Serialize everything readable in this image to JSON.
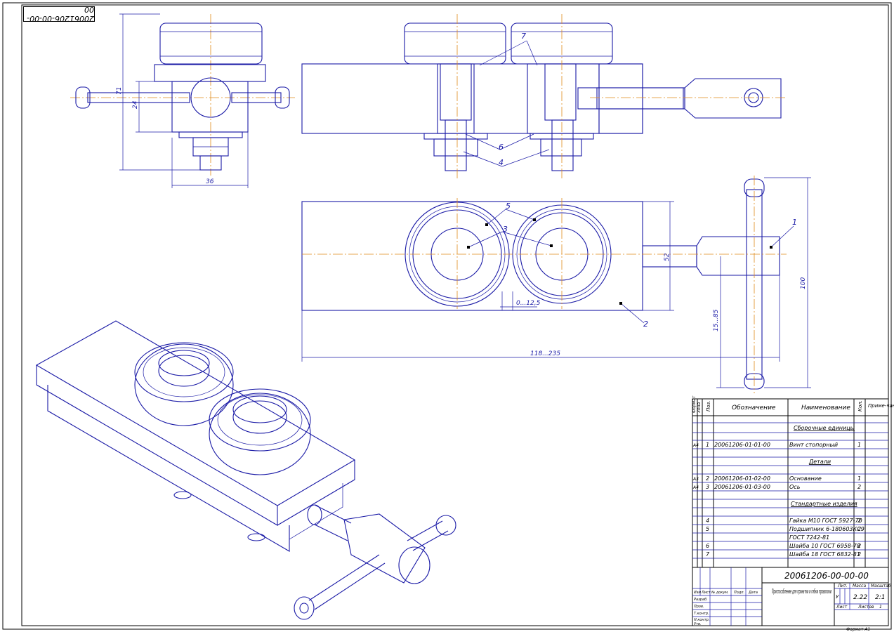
{
  "drawing_code_rotated": "20061206-00-00-00",
  "dims": {
    "d36": "36",
    "d71": "71",
    "d24": "24",
    "d52": "52",
    "d0125": "0...12,5",
    "d118": "118...235",
    "d100": "100",
    "d15": "15...85"
  },
  "callouts": {
    "c1": "1",
    "c2": "2",
    "c3": "3",
    "c4": "4",
    "c5": "5",
    "c6": "6",
    "c7": "7"
  },
  "spec": {
    "headers": {
      "zone": "Формат",
      "zone2": "Зона",
      "pos": "Поз.",
      "desig": "Обозначение",
      "name": "Наименование",
      "qty": "Кол.",
      "note": "Приме-чание"
    },
    "sections": {
      "assembly": "Сборочные единицы",
      "parts": "Детали",
      "standard": "Стандартные изделия"
    },
    "rows": [
      {
        "fmt": "А4",
        "pos": "1",
        "desig": "20061206-01-01-00",
        "name": "Винт стопорный",
        "qty": "1"
      },
      {
        "fmt": "А3",
        "pos": "2",
        "desig": "20061206-01-02-00",
        "name": "Основание",
        "qty": "1"
      },
      {
        "fmt": "А4",
        "pos": "3",
        "desig": "20061206-01-03-00",
        "name": "Ось",
        "qty": "2"
      },
      {
        "fmt": "",
        "pos": "4",
        "desig": "",
        "name": "Гайка М10 ГОСТ 5927-70",
        "qty": "2"
      },
      {
        "fmt": "",
        "pos": "5",
        "desig": "",
        "name": "Подшипник 6-180603КС9",
        "qty": "2"
      },
      {
        "fmt": "",
        "pos": "",
        "desig": "",
        "name": "ГОСТ 7242-81",
        "qty": ""
      },
      {
        "fmt": "",
        "pos": "6",
        "desig": "",
        "name": "Шайба 10 ГОСТ 6958-78",
        "qty": "2"
      },
      {
        "fmt": "",
        "pos": "7",
        "desig": "",
        "name": "Шайба 18 ГОСТ 6832-81",
        "qty": "2"
      }
    ]
  },
  "title_block": {
    "code": "20061206-00-00-00",
    "title": "Приспособление для прокатки и гибки проволоки",
    "lit_label": "Лит.",
    "mass_label": "Масса",
    "scale_label": "Масштаб",
    "lit_value": "У",
    "mass_value": "2.22",
    "scale_value": "2:1",
    "sheet_label": "Лист",
    "sheets_label": "Листов",
    "sheets_value": "1",
    "roles": [
      "Изм",
      "Лист",
      "№ докум.",
      "Подп.",
      "Дата"
    ],
    "people": [
      "Разраб.",
      "Пров.",
      "Т.контр.",
      "Н.контр.",
      "Утв."
    ],
    "format": "Формат А1"
  }
}
